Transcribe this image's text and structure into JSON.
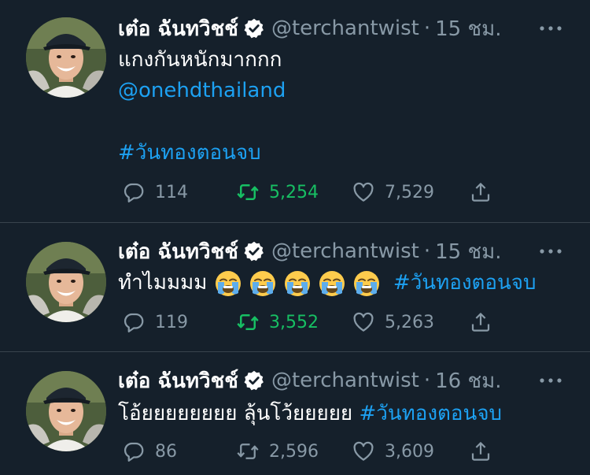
{
  "tweets": [
    {
      "name": "เต๋อ ฉันทวิชช์",
      "handle": "@terchantwist",
      "time": "15 ชม.",
      "lines": [
        "แกงกันหนักมากกก"
      ],
      "mention": "@onehdthailand",
      "hashtag": "#วันทองตอนจบ",
      "replies": "114",
      "retweets": "5,254",
      "retweeted": true,
      "likes": "7,529"
    },
    {
      "name": "เต๋อ ฉันทวิชช์",
      "handle": "@terchantwist",
      "time": "15 ชม.",
      "text": "ทำไมมมม",
      "emoji": "loudly-crying-face",
      "emoji_count": 5,
      "hashtag": "#วันทองตอนจบ",
      "replies": "119",
      "retweets": "3,552",
      "retweeted": true,
      "likes": "5,263"
    },
    {
      "name": "เต๋อ ฉันทวิชช์",
      "handle": "@terchantwist",
      "time": "16 ชม.",
      "text": "โอ้ยยยยยยยย ลุ้นโว้ยยยยย",
      "hashtag": "#วันทองตอนจบ",
      "replies": "86",
      "retweets": "2,596",
      "retweeted": false,
      "likes": "3,609"
    }
  ],
  "separator_dot": "·",
  "colors": {
    "background": "#15202b",
    "secondary_text": "#8899a6",
    "link": "#1da1f2",
    "retweet_active": "#17bf63",
    "divider": "#38444d"
  },
  "icons": [
    "verified-badge-icon",
    "more-options-icon",
    "reply-icon",
    "retweet-icon",
    "like-icon",
    "share-icon"
  ]
}
